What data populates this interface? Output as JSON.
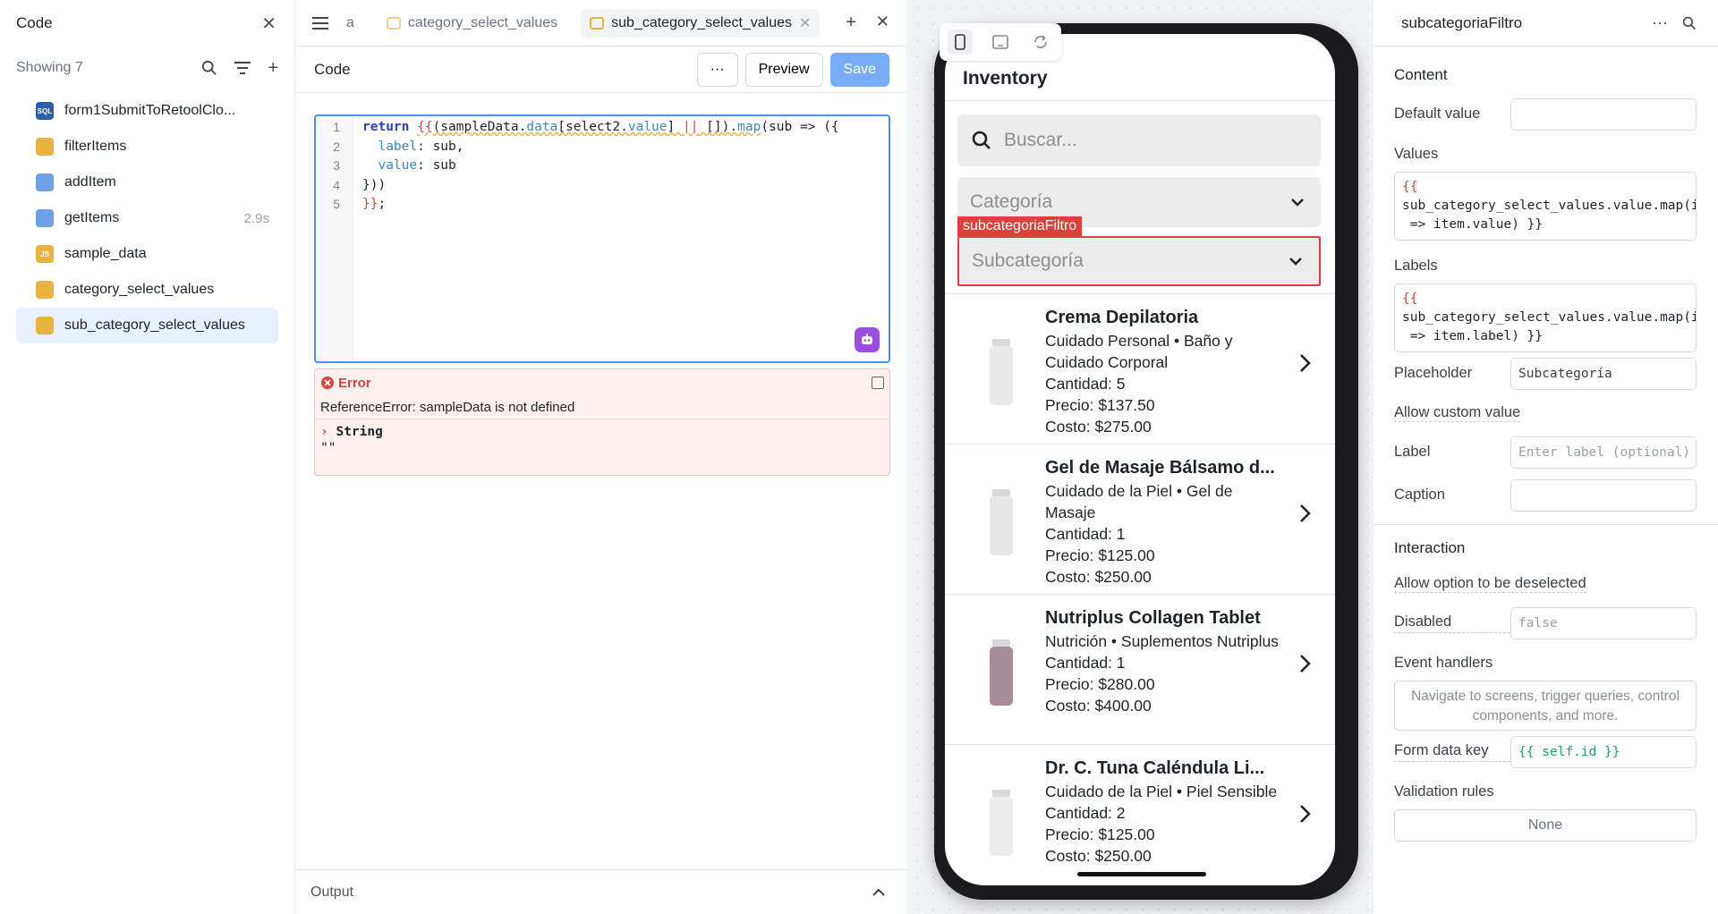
{
  "left": {
    "title": "Code",
    "showing": "Showing 7",
    "items": [
      {
        "label": "form1SubmitToRetoolClo...",
        "icon": "sql-icon",
        "time": ""
      },
      {
        "label": "filterItems",
        "icon": "transformer-icon",
        "time": ""
      },
      {
        "label": "addItem",
        "icon": "database-icon",
        "time": ""
      },
      {
        "label": "getItems",
        "icon": "database-icon",
        "time": "2.9s"
      },
      {
        "label": "sample_data",
        "icon": "js-icon",
        "time": ""
      },
      {
        "label": "category_select_values",
        "icon": "transformer-icon",
        "time": ""
      },
      {
        "label": "sub_category_select_values",
        "icon": "transformer-icon",
        "time": ""
      }
    ],
    "icon_badges": {
      "sql": "SQL",
      "js": "JS"
    }
  },
  "mid": {
    "tabs": [
      {
        "label": "a"
      },
      {
        "label": "category_select_values"
      },
      {
        "label": "sub_category_select_values"
      }
    ],
    "panel_title": "Code",
    "more_label": "···",
    "preview_label": "Preview",
    "save_label": "Save",
    "line_numbers": [
      "1",
      "2",
      "3",
      "4",
      "5"
    ],
    "code": {
      "l1_kw": "return",
      "l1_a": "{{",
      "l1_b": "(sampleData.",
      "l1_c": "data",
      "l1_d": "[select2.",
      "l1_e": "value",
      "l1_f": "] ",
      "l1_g": "||",
      "l1_h": " []).",
      "l1_i": "map",
      "l1_j": "(sub => ({",
      "l2_a": "  label",
      "l2_b": ": sub,",
      "l3_a": "  value",
      "l3_b": ": sub",
      "l4": "}))",
      "l5_a": "}}",
      "l5_b": ";"
    },
    "error": {
      "title": "Error",
      "message": "ReferenceError: sampleData is not defined",
      "type": "String",
      "value": "\"\""
    },
    "output_label": "Output"
  },
  "app": {
    "title": "Inventory",
    "search_placeholder": "Buscar...",
    "category_placeholder": "Categoría",
    "selected_component": "subcategoriaFiltro",
    "subcategory_placeholder": "Subcategoría",
    "products": [
      {
        "name": "Crema Depilatoria",
        "category": "Cuidado Personal • Baño y Cuidado Corporal",
        "qty": "Cantidad: 5",
        "price": "Precio: $137.50",
        "cost": "Costo: $275.00",
        "bottle": "#e9e9e9"
      },
      {
        "name": "Gel de Masaje Bálsamo d...",
        "category": "Cuidado de la Piel • Gel de Masaje",
        "qty": "Cantidad: 1",
        "price": "Precio: $125.00",
        "cost": "Costo: $250.00",
        "bottle": "#e6e6e6"
      },
      {
        "name": "Nutriplus Collagen Tablet",
        "category": "Nutrición • Suplementos Nutriplus",
        "qty": "Cantidad: 1",
        "price": "Precio: $280.00",
        "cost": "Costo: $400.00",
        "bottle": "#a88b98"
      },
      {
        "name": "Dr. C. Tuna Caléndula Li...",
        "category": "Cuidado de la Piel • Piel Sensible",
        "qty": "Cantidad: 2",
        "price": "Precio: $125.00",
        "cost": "Costo: $250.00",
        "bottle": "#ececec"
      }
    ]
  },
  "inspector": {
    "title": "subcategoriaFiltro",
    "more_label": "···",
    "content_head": "Content",
    "default_value_label": "Default value",
    "default_value": "",
    "values_label": "Values",
    "values_l1": "{{",
    "values_l2": "sub_category_select_values.value.map(it",
    "values_l3": " => item.value) }}",
    "labels_label": "Labels",
    "labels_l1": "{{",
    "labels_l2": "sub_category_select_values.value.map(it",
    "labels_l3": " => item.label) }}",
    "placeholder_label": "Placeholder",
    "placeholder_value": "Subcategoría",
    "allow_custom_label": "Allow custom value",
    "label_label": "Label",
    "label_placeholder": "Enter label (optional)",
    "caption_label": "Caption",
    "caption_value": "",
    "interaction_head": "Interaction",
    "deselect_label": "Allow option to be deselected",
    "disabled_label": "Disabled",
    "disabled_placeholder": "false",
    "event_handlers_label": "Event handlers",
    "event_handlers_hint": "Navigate to screens, trigger queries, control components, and more.",
    "form_key_label": "Form data key",
    "form_key_value": "{{ self.id }}",
    "validation_label": "Validation rules",
    "validation_value": "None"
  },
  "colors": {
    "accent": "#78acf6",
    "error": "#d9423a",
    "active_item": "#e8f0fe"
  }
}
